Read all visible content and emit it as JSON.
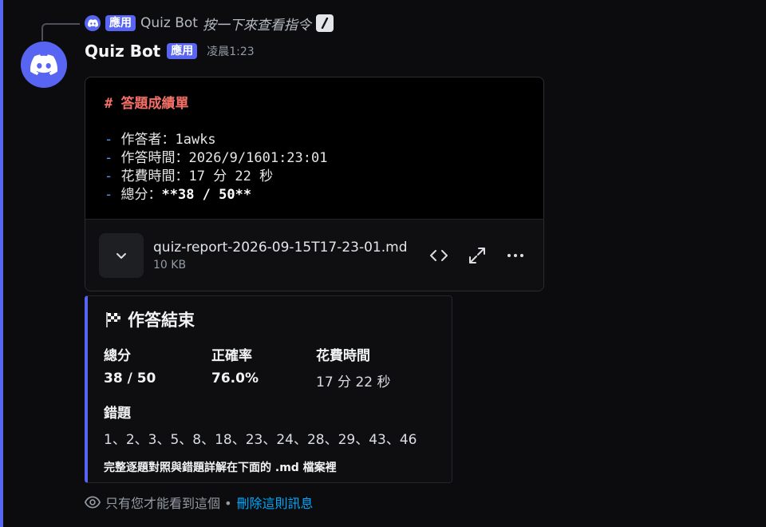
{
  "colors": {
    "accent": "#5865f2",
    "link": "#00a8fc",
    "heading": "#f47067",
    "dash": "#539bf5"
  },
  "reply": {
    "badge": "應用",
    "name": "Quiz Bot",
    "command": "按一下來查看指令"
  },
  "message": {
    "username": "Quiz Bot",
    "badge": "應用",
    "timestamp": "凌晨1:23"
  },
  "file_preview": {
    "title": "# 答題成績單",
    "lines": [
      {
        "dash": "-",
        "text": " 作答者：1awks",
        "bold": ""
      },
      {
        "dash": "-",
        "text": " 作答時間：2026/9/1601:23:01",
        "bold": ""
      },
      {
        "dash": "-",
        "text": " 花費時間：17 分 22 秒",
        "bold": ""
      },
      {
        "dash": "-",
        "text": " 總分：",
        "bold": "**38 / 50**"
      }
    ],
    "file_name": "quiz-report-2026-09-15T17-23-01.md",
    "file_size": "10 KB"
  },
  "embed": {
    "title": "作答結束",
    "title_icon": "checkered-flag-icon",
    "fields": [
      {
        "name": "總分",
        "value": "38 / 50",
        "bold": true
      },
      {
        "name": "正確率",
        "value": "76.0%",
        "bold": true
      },
      {
        "name": "花費時間",
        "value": "17 分 22 秒",
        "bold": false
      }
    ],
    "wrong_name": "錯題",
    "wrong_value": "1、2、3、5、8、18、23、24、28、29、43、46",
    "footer": "完整逐題對照與錯題詳解在下面的 .md 檔案裡"
  },
  "ephemeral": {
    "text": "只有您才能看到這個 •",
    "link": "刪除這則訊息"
  }
}
